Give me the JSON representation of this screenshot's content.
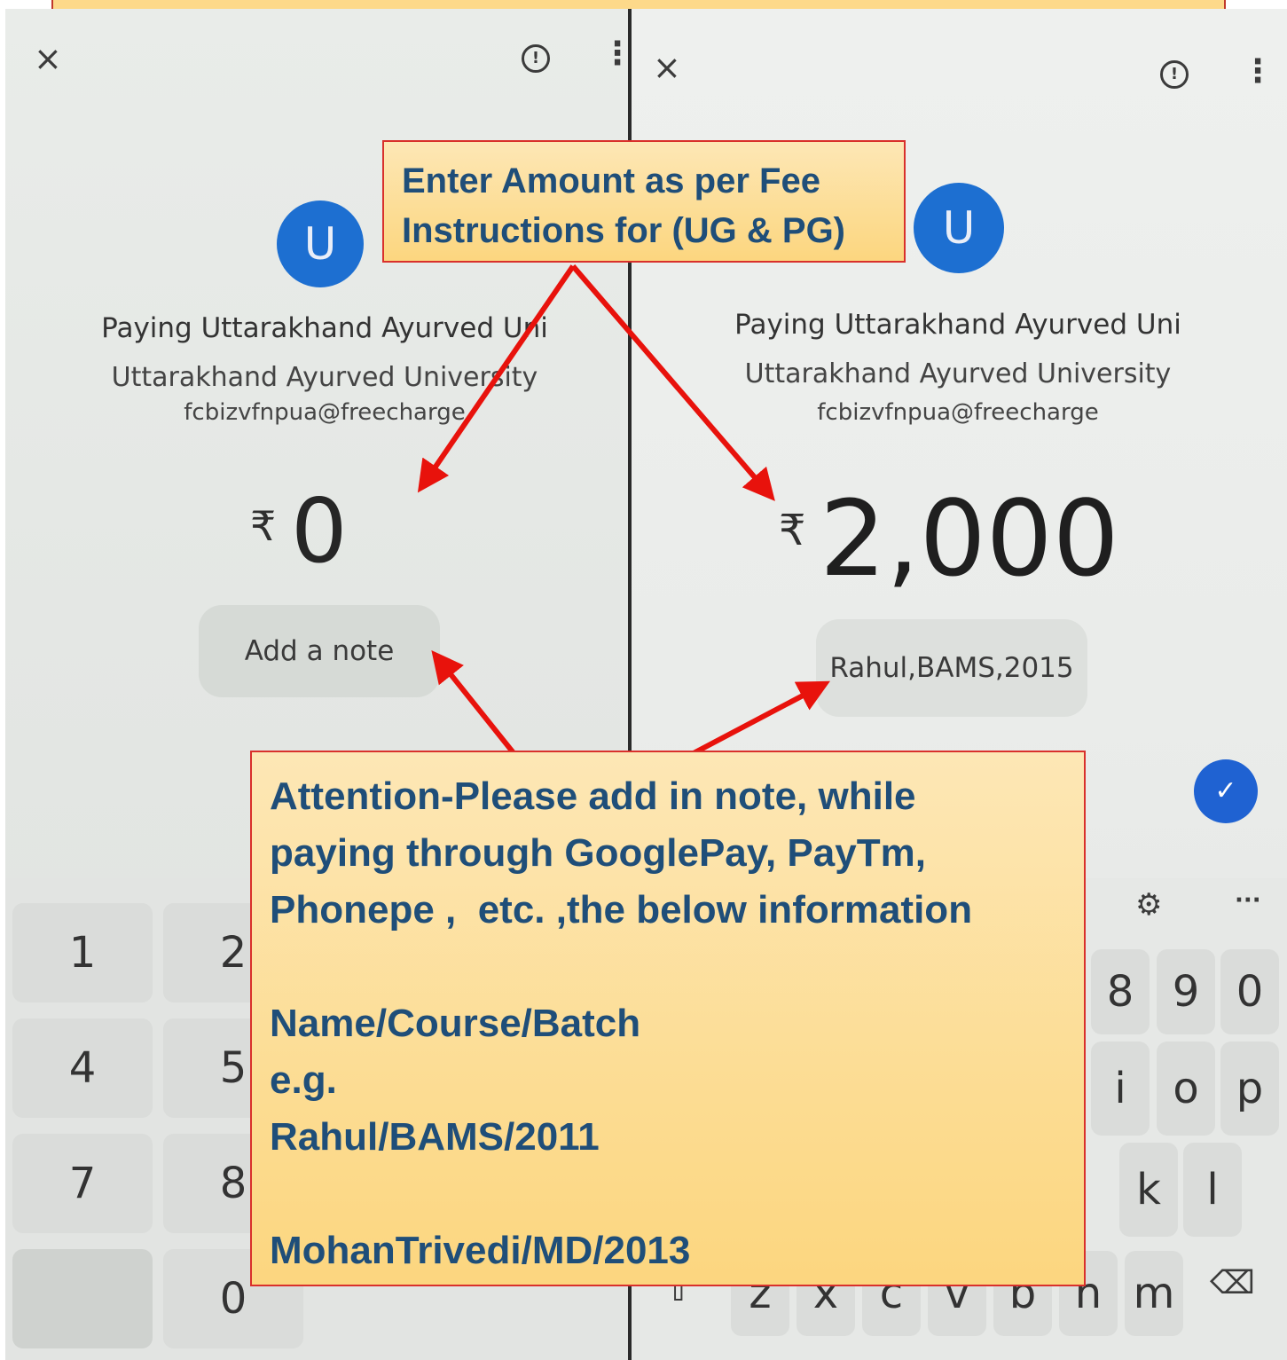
{
  "left_screen": {
    "close_glyph": "×",
    "avatar_letter": "U",
    "payee_name": "Paying Uttarakhand Ayurved Uni",
    "payee_org": "Uttarakhand Ayurved University",
    "payee_upi": "fcbizvfnpua@freecharge",
    "currency": "₹",
    "amount": "0",
    "note_placeholder": "Add a note",
    "keypad": [
      "1",
      "2",
      "4",
      "5",
      "7",
      "8",
      "0"
    ]
  },
  "right_screen": {
    "close_glyph": "×",
    "avatar_letter": "U",
    "payee_name": "Paying Uttarakhand Ayurved Uni",
    "payee_org": "Uttarakhand Ayurved University",
    "payee_upi": "fcbizvfnpua@freecharge",
    "currency": "₹",
    "amount": "2,000",
    "note_value": "Rahul,BAMS,2015",
    "keyboard": {
      "row_digits": [
        "8",
        "9",
        "0"
      ],
      "row_top": [
        "i",
        "o",
        "p"
      ],
      "row_mid": [
        "k",
        "l"
      ],
      "row_bottom": [
        "z",
        "x",
        "c",
        "v",
        "b",
        "n",
        "m"
      ],
      "more_glyph": "···"
    }
  },
  "callouts": {
    "amount_instruction": "Enter Amount as per Fee\nInstructions for (UG & PG)",
    "note_instruction": "Attention-Please add in note, while\npaying through GooglePay, PayTm,\nPhonepe ,  etc. ,the below information\n\nName/Course/Batch\ne.g.\nRahul/BAMS/2011\n\nMohanTrivedi/MD/2013"
  },
  "colors": {
    "callout_fill": "#fdd98a",
    "callout_border": "#d9302b",
    "callout_text": "#1f4e79",
    "arrow": "#e8120c",
    "avatar": "#1d6fd1",
    "confirm_button": "#1f62d2"
  }
}
